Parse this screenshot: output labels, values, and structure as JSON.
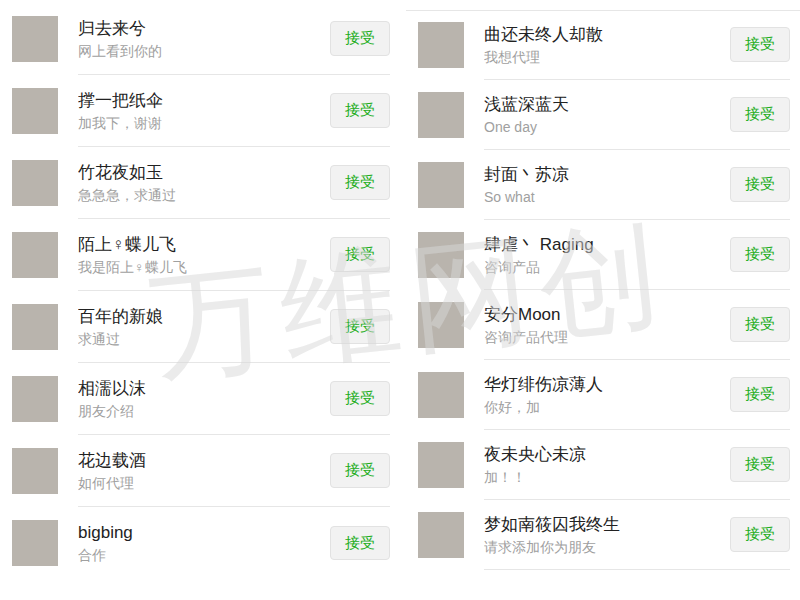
{
  "watermark": "万维网创",
  "columns": [
    {
      "requests": [
        {
          "name": "归去来兮",
          "message": "网上看到你的",
          "button": "接受"
        },
        {
          "name": "撑一把纸伞",
          "message": "加我下，谢谢",
          "button": "接受"
        },
        {
          "name": "竹花夜如玉",
          "message": "急急急，求通过",
          "button": "接受"
        },
        {
          "name": "陌上♀蝶儿飞",
          "message": "我是陌上♀蝶儿飞",
          "button": "接受"
        },
        {
          "name": "百年的新娘",
          "message": "求通过",
          "button": "接受"
        },
        {
          "name": "相濡以沫",
          "message": "朋友介绍",
          "button": "接受"
        },
        {
          "name": "花边载酒",
          "message": "如何代理",
          "button": "接受"
        },
        {
          "name": "bigbing",
          "message": "合作",
          "button": "接受"
        }
      ]
    },
    {
      "requests": [
        {
          "name": "曲还未终人却散",
          "message": "我想代理",
          "button": "接受"
        },
        {
          "name": "浅蓝深蓝天",
          "message": "One day",
          "button": "接受"
        },
        {
          "name": "封面丶苏凉",
          "message": "So what",
          "button": "接受"
        },
        {
          "name": "肆虐丶 Raging",
          "message": "咨询产品",
          "button": "接受"
        },
        {
          "name": "安分Moon",
          "message": "咨询产品代理",
          "button": "接受"
        },
        {
          "name": "华灯绯伤凉薄人",
          "message": "你好，加",
          "button": "接受"
        },
        {
          "name": "夜未央心未凉",
          "message": "加！！",
          "button": "接受"
        },
        {
          "name": "梦如南筱囚我终生",
          "message": "请求添加你为朋友",
          "button": "接受"
        }
      ]
    }
  ]
}
